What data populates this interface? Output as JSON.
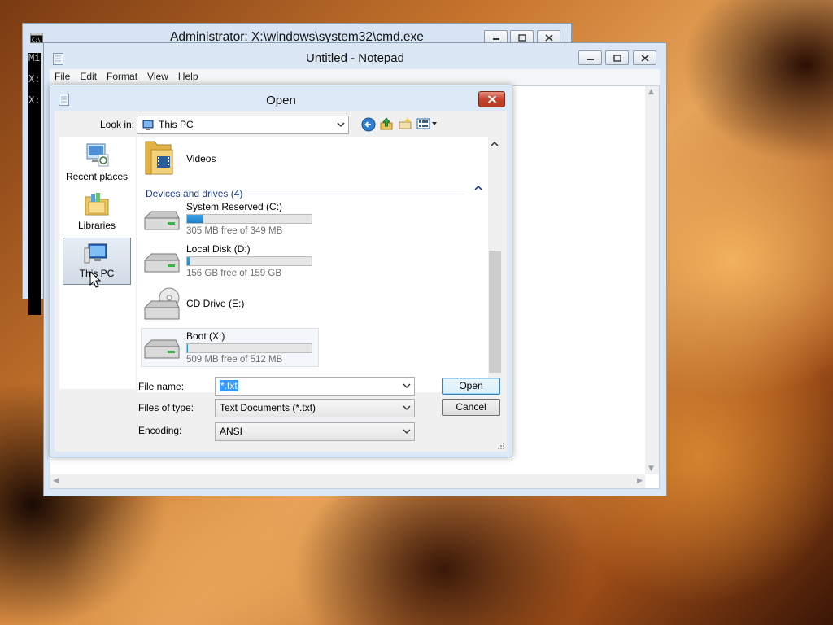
{
  "cmd": {
    "title": "Administrator: X:\\windows\\system32\\cmd.exe",
    "lines": [
      "Mi",
      "X:",
      "X:"
    ]
  },
  "notepad": {
    "title": "Untitled - Notepad",
    "menu": [
      "File",
      "Edit",
      "Format",
      "View",
      "Help"
    ]
  },
  "dialog": {
    "title": "Open",
    "look_in_label": "Look in:",
    "look_in_value": "This PC",
    "places": [
      {
        "label": "Recent places",
        "icon": "recent-places-icon"
      },
      {
        "label": "Libraries",
        "icon": "libraries-icon"
      },
      {
        "label": "This PC",
        "icon": "this-pc-icon",
        "selected": true
      }
    ],
    "folder_item": "Videos",
    "group_header": "Devices and drives (4)",
    "drives": [
      {
        "name": "System Reserved (C:)",
        "free": "305 MB free of 349 MB",
        "used_fraction": 0.13,
        "icon": "hard-drive-icon"
      },
      {
        "name": "Local Disk (D:)",
        "free": "156 GB free of 159 GB",
        "used_fraction": 0.02,
        "icon": "hard-drive-icon"
      },
      {
        "name": "CD Drive (E:)",
        "free": "",
        "icon": "cd-drive-icon"
      },
      {
        "name": "Boot (X:)",
        "free": "509 MB free of 512 MB",
        "used_fraction": 0.006,
        "icon": "hard-drive-icon"
      }
    ],
    "file_name_label": "File name:",
    "file_name_value": "*.txt",
    "file_type_label": "Files of type:",
    "file_type_value": "Text Documents (*.txt)",
    "encoding_label": "Encoding:",
    "encoding_value": "ANSI",
    "open_button": "Open",
    "cancel_button": "Cancel"
  },
  "colors": {
    "progress_fill": "#26a0da",
    "group_header": "#1e3d8f",
    "close_button": "#c7432c"
  }
}
